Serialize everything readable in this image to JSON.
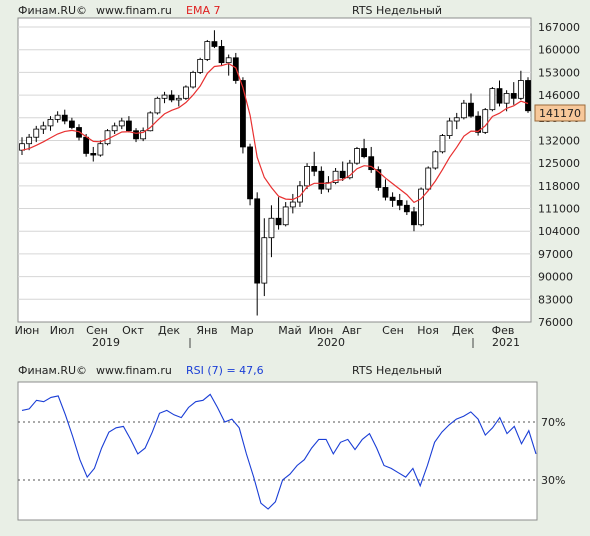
{
  "chart_data": [
    {
      "type": "candlestick",
      "header": {
        "source": "Финам.RU©",
        "site": "www.finam.ru",
        "indicator": "EMA 7",
        "title": "RTS Недельный"
      },
      "last_price_label": "141170",
      "y_ticks": [
        "167000",
        "160000",
        "153000",
        "146000",
        "139000",
        "132000",
        "125000",
        "118000",
        "111000",
        "104000",
        "97000",
        "90000",
        "83000",
        "76000"
      ],
      "x_month_labels": [
        "Июн",
        "Июл",
        "Сен",
        "Окт",
        "Дек",
        "Янв",
        "Мар",
        "Май",
        "Июн",
        "Авг",
        "Сен",
        "Ноя",
        "Дек",
        "Фев"
      ],
      "x_year_labels": [
        "2019",
        "2020",
        "2021"
      ],
      "ylim": [
        76000,
        170000
      ],
      "colors": {
        "up": "#ffffff",
        "down": "#000000",
        "ema": "#e83030"
      },
      "candles": [
        [
          129000,
          133000,
          127500,
          131000
        ],
        [
          131000,
          134000,
          129000,
          133000
        ],
        [
          133000,
          136500,
          131500,
          135500
        ],
        [
          135500,
          137800,
          134000,
          136500
        ],
        [
          136500,
          139500,
          135000,
          138500
        ],
        [
          138500,
          141000,
          137500,
          139800
        ],
        [
          139800,
          141500,
          137000,
          138000
        ],
        [
          138000,
          139000,
          135500,
          136000
        ],
        [
          136000,
          137000,
          132000,
          133000
        ],
        [
          133000,
          134000,
          127000,
          128000
        ],
        [
          128000,
          130000,
          125500,
          127500
        ],
        [
          127500,
          132000,
          127000,
          131000
        ],
        [
          131000,
          135500,
          130500,
          135000
        ],
        [
          135000,
          137500,
          134000,
          136500
        ],
        [
          136500,
          139000,
          135500,
          138000
        ],
        [
          138000,
          139500,
          134500,
          135000
        ],
        [
          135000,
          135800,
          131500,
          132500
        ],
        [
          132500,
          136000,
          131800,
          135000
        ],
        [
          135000,
          141000,
          134800,
          140500
        ],
        [
          140500,
          145500,
          140000,
          145000
        ],
        [
          145000,
          147000,
          143500,
          146000
        ],
        [
          146000,
          147500,
          143800,
          144500
        ],
        [
          144500,
          146000,
          142500,
          145000
        ],
        [
          145000,
          149000,
          144500,
          148500
        ],
        [
          148500,
          153500,
          148000,
          153000
        ],
        [
          153000,
          157500,
          152500,
          157000
        ],
        [
          157000,
          163000,
          156500,
          162500
        ],
        [
          162500,
          166000,
          160500,
          161000
        ],
        [
          161000,
          163000,
          155000,
          156000
        ],
        [
          156000,
          158500,
          152000,
          157500
        ],
        [
          157500,
          159000,
          149500,
          150500
        ],
        [
          150500,
          151500,
          128000,
          130000
        ],
        [
          130000,
          131000,
          112000,
          114000
        ],
        [
          114000,
          116000,
          78000,
          88000
        ],
        [
          88000,
          108000,
          84000,
          102000
        ],
        [
          102000,
          112000,
          96000,
          108000
        ],
        [
          108000,
          114500,
          104500,
          106000
        ],
        [
          106000,
          113000,
          105500,
          111500
        ],
        [
          111500,
          115500,
          109500,
          113000
        ],
        [
          113000,
          119500,
          111500,
          118000
        ],
        [
          118000,
          125000,
          117000,
          124000
        ],
        [
          124000,
          128500,
          121000,
          122500
        ],
        [
          122500,
          124000,
          115500,
          117000
        ],
        [
          117000,
          121000,
          116000,
          119000
        ],
        [
          119000,
          123500,
          118500,
          122500
        ],
        [
          122500,
          125500,
          119500,
          120500
        ],
        [
          120500,
          126000,
          120000,
          125000
        ],
        [
          125000,
          130000,
          124500,
          129500
        ],
        [
          129500,
          132500,
          126500,
          127000
        ],
        [
          127000,
          130000,
          122000,
          123000
        ],
        [
          123000,
          124000,
          116500,
          117500
        ],
        [
          117500,
          120000,
          113500,
          114500
        ],
        [
          114500,
          116000,
          111500,
          113500
        ],
        [
          113500,
          115500,
          110500,
          112000
        ],
        [
          112000,
          113500,
          109000,
          110000
        ],
        [
          110000,
          111500,
          104000,
          106000
        ],
        [
          106000,
          117500,
          105500,
          117000
        ],
        [
          117000,
          124000,
          116500,
          123500
        ],
        [
          123500,
          129000,
          123000,
          128500
        ],
        [
          128500,
          134000,
          128000,
          133500
        ],
        [
          133500,
          139000,
          132500,
          138000
        ],
        [
          138000,
          140500,
          135500,
          139000
        ],
        [
          139000,
          144500,
          138500,
          143500
        ],
        [
          143500,
          146500,
          139000,
          139500
        ],
        [
          139500,
          141000,
          133500,
          134500
        ],
        [
          134500,
          142000,
          134000,
          141500
        ],
        [
          141500,
          148500,
          141000,
          148000
        ],
        [
          148000,
          150500,
          142500,
          143500
        ],
        [
          143500,
          147500,
          141000,
          146500
        ],
        [
          146500,
          150000,
          143000,
          145000
        ],
        [
          145000,
          153500,
          144500,
          150500
        ],
        [
          150500,
          151500,
          140500,
          141170
        ]
      ],
      "ema": [
        129000,
        129500,
        130500,
        131600,
        132800,
        134000,
        134800,
        135100,
        134700,
        133200,
        131700,
        131600,
        132400,
        133500,
        134600,
        134700,
        134200,
        134500,
        136000,
        138200,
        140200,
        141300,
        142100,
        143700,
        146000,
        148800,
        152700,
        154800,
        155100,
        155700,
        154400,
        148300,
        139800,
        126800,
        120600,
        117500,
        114800,
        113900,
        113800,
        114800,
        117700,
        118800,
        118800,
        118800,
        119700,
        119900,
        121200,
        123300,
        124200,
        124000,
        122400,
        120400,
        118700,
        117000,
        115300,
        112900,
        114000,
        116500,
        119500,
        123000,
        126800,
        129900,
        133300,
        134900,
        134800,
        136500,
        139400,
        140400,
        141900,
        142700,
        144100,
        143400
      ]
    },
    {
      "type": "line",
      "header": {
        "source": "Финам.RU©",
        "site": "www.finam.ru",
        "indicator": "RSI (7) = 47,6",
        "title": "RTS Недельный"
      },
      "y_ticks": [
        "70%",
        "30%"
      ],
      "levels": [
        70,
        30
      ],
      "ylim": [
        5,
        97
      ],
      "color": "#1a3ed6",
      "values": [
        78,
        79,
        85,
        84,
        87,
        88,
        75,
        60,
        44,
        32,
        38,
        52,
        63,
        66,
        67,
        58,
        48,
        52,
        63,
        76,
        78,
        75,
        73,
        80,
        84,
        85,
        89,
        80,
        70,
        72,
        66,
        48,
        32,
        14,
        10,
        15,
        30,
        34,
        40,
        44,
        52,
        58,
        58,
        48,
        56,
        58,
        51,
        58,
        62,
        52,
        40,
        38,
        35,
        32,
        38,
        26,
        40,
        56,
        63,
        68,
        72,
        74,
        77,
        72,
        61,
        66,
        73,
        62,
        67,
        55,
        64,
        48
      ]
    }
  ]
}
